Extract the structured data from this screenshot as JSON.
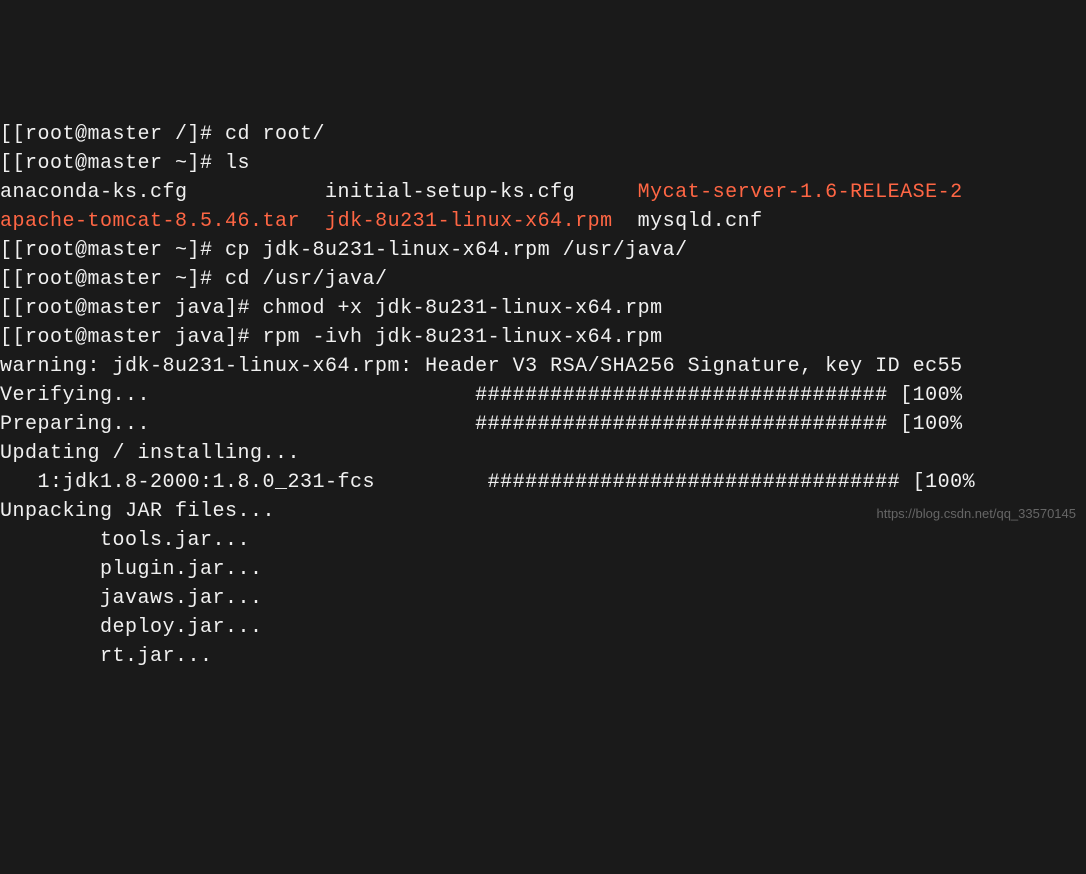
{
  "terminal": {
    "lines": [
      {
        "segments": [
          {
            "text": "[[root@master /]# cd root/"
          }
        ]
      },
      {
        "segments": [
          {
            "text": "[[root@master ~]# ls"
          }
        ]
      },
      {
        "segments": [
          {
            "text": "anaconda-ks.cfg           initial-setup-ks.cfg     "
          },
          {
            "text": "Mycat-server-1.6-RELEASE-2",
            "cls": "highlight"
          }
        ]
      },
      {
        "segments": [
          {
            "text": "apache-tomcat-8.5.46.tar",
            "cls": "highlight"
          },
          {
            "text": "  "
          },
          {
            "text": "jdk-8u231-linux-x64.rpm",
            "cls": "highlight"
          },
          {
            "text": "  mysqld.cnf"
          }
        ]
      },
      {
        "segments": [
          {
            "text": "[[root@master ~]# cp jdk-8u231-linux-x64.rpm /usr/java/"
          }
        ]
      },
      {
        "segments": [
          {
            "text": "[[root@master ~]# cd /usr/java/"
          }
        ]
      },
      {
        "segments": [
          {
            "text": "[[root@master java]# chmod +x jdk-8u231-linux-x64.rpm"
          }
        ]
      },
      {
        "segments": [
          {
            "text": "[[root@master java]# rpm -ivh jdk-8u231-linux-x64.rpm"
          }
        ]
      },
      {
        "segments": [
          {
            "text": "warning: jdk-8u231-linux-x64.rpm: Header V3 RSA/SHA256 Signature, key ID ec55"
          }
        ]
      },
      {
        "segments": [
          {
            "text": "Verifying...                          ################################# [100%"
          }
        ]
      },
      {
        "segments": [
          {
            "text": "Preparing...                          ################################# [100%"
          }
        ]
      },
      {
        "segments": [
          {
            "text": "Updating / installing..."
          }
        ]
      },
      {
        "segments": [
          {
            "text": "   1:jdk1.8-2000:1.8.0_231-fcs         ################################# [100%"
          }
        ]
      },
      {
        "segments": [
          {
            "text": "Unpacking JAR files..."
          }
        ]
      },
      {
        "segments": [
          {
            "text": "        tools.jar..."
          }
        ]
      },
      {
        "segments": [
          {
            "text": "        plugin.jar..."
          }
        ]
      },
      {
        "segments": [
          {
            "text": "        javaws.jar..."
          }
        ]
      },
      {
        "segments": [
          {
            "text": "        deploy.jar..."
          }
        ]
      },
      {
        "segments": [
          {
            "text": "        rt.jar..."
          }
        ]
      }
    ]
  },
  "watermark": "https://blog.csdn.net/qq_33570145"
}
